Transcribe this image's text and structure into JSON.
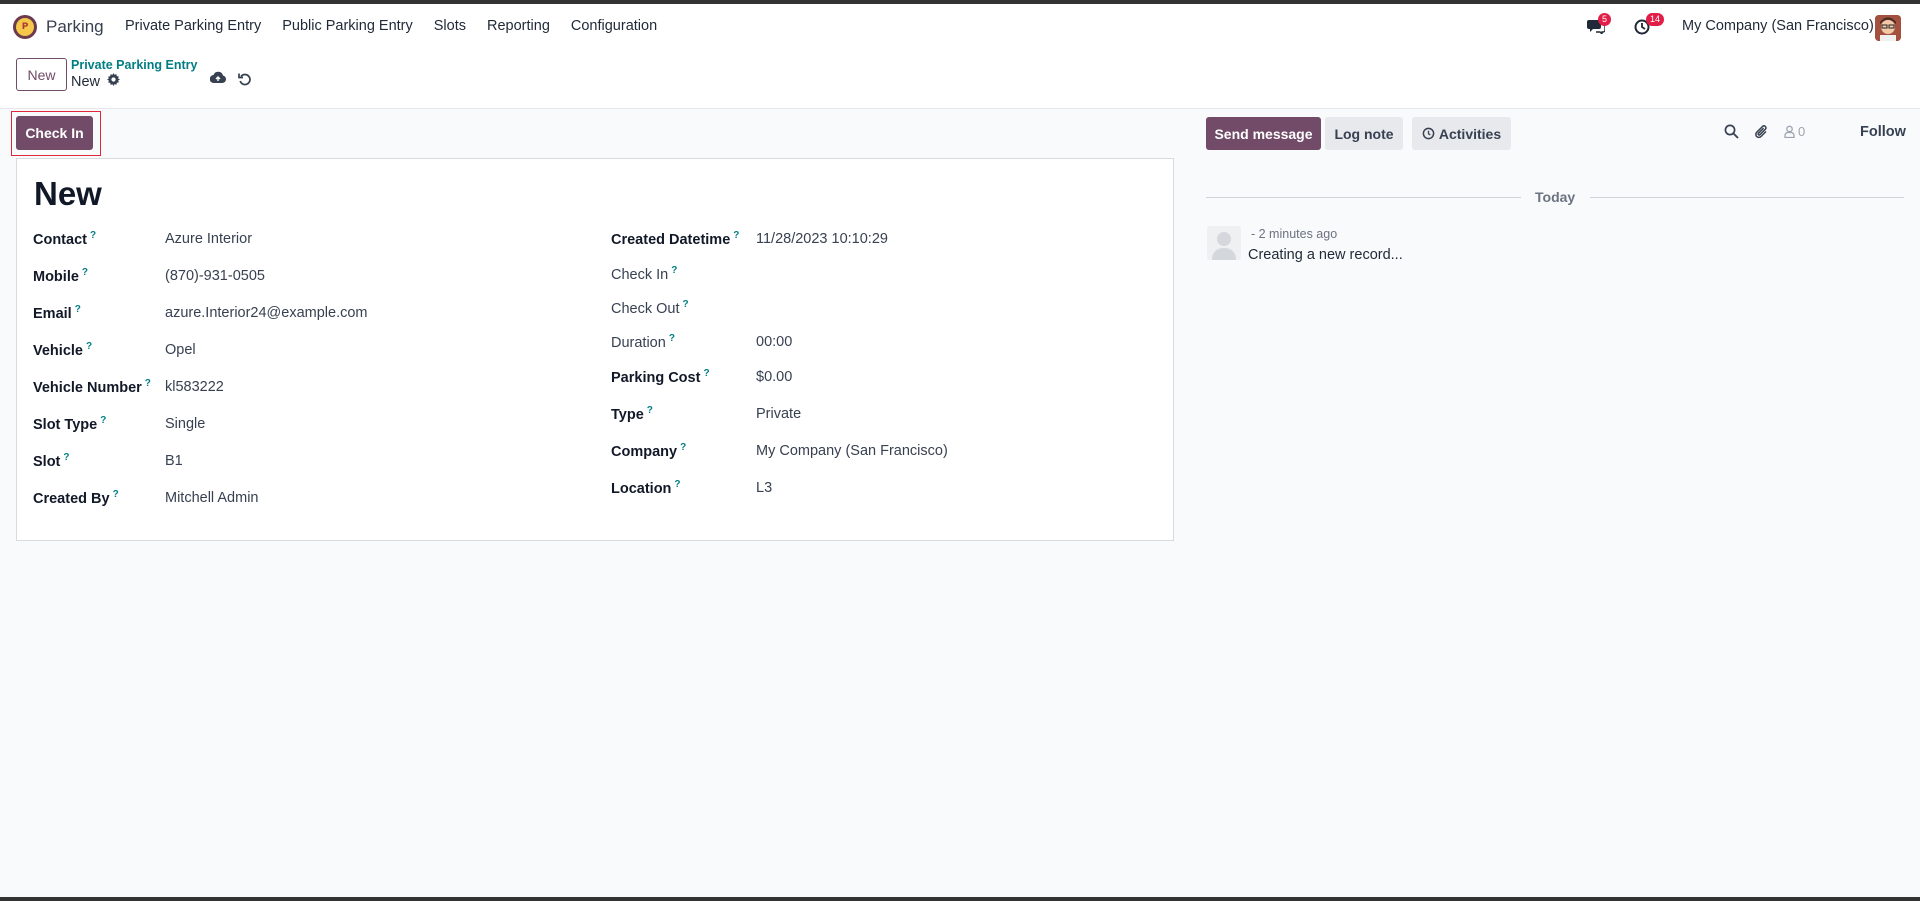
{
  "navbar": {
    "app_name": "Parking",
    "menu": [
      "Private Parking Entry",
      "Public Parking Entry",
      "Slots",
      "Reporting",
      "Configuration"
    ],
    "messages_badge": "5",
    "activities_badge": "14",
    "company": "My Company (San Francisco)"
  },
  "control": {
    "new_label": "New",
    "breadcrumb": "Private Parking Entry",
    "record_name": "New"
  },
  "status": {
    "check_in_label": "Check In"
  },
  "form": {
    "title": "New",
    "left_fields": [
      {
        "label": "Contact",
        "value": "Azure Interior"
      },
      {
        "label": "Mobile",
        "value": "(870)-931-0505"
      },
      {
        "label": "Email",
        "value": "azure.Interior24@example.com"
      },
      {
        "label": "Vehicle",
        "value": "Opel"
      },
      {
        "label": "Vehicle Number",
        "value": "kl583222"
      },
      {
        "label": "Slot Type",
        "value": "Single"
      },
      {
        "label": "Slot",
        "value": "B1"
      },
      {
        "label": "Created By",
        "value": "Mitchell Admin"
      }
    ],
    "right_fields": [
      {
        "label": "Created Datetime",
        "value": "11/28/2023 10:10:29"
      },
      {
        "label": "Check In",
        "value": ""
      },
      {
        "label": "Check Out",
        "value": ""
      },
      {
        "label": "Duration",
        "value": "00:00"
      },
      {
        "label": "Parking Cost",
        "value": "$0.00"
      },
      {
        "label": "Type",
        "value": "Private"
      },
      {
        "label": "Company",
        "value": "My Company (San Francisco)"
      },
      {
        "label": "Location",
        "value": "L3"
      }
    ],
    "help_mark": "?"
  },
  "chatter": {
    "send_message": "Send message",
    "log_note": "Log note",
    "activities": "Activities",
    "followers_count": "0",
    "follow": "Follow",
    "date_separator": "Today",
    "message_time": "- 2 minutes ago",
    "message_body": "Creating a new record..."
  },
  "colors": {
    "primary": "#714b67",
    "teal": "#017e84",
    "badge": "#e11d48",
    "highlight": "#e0283a"
  }
}
